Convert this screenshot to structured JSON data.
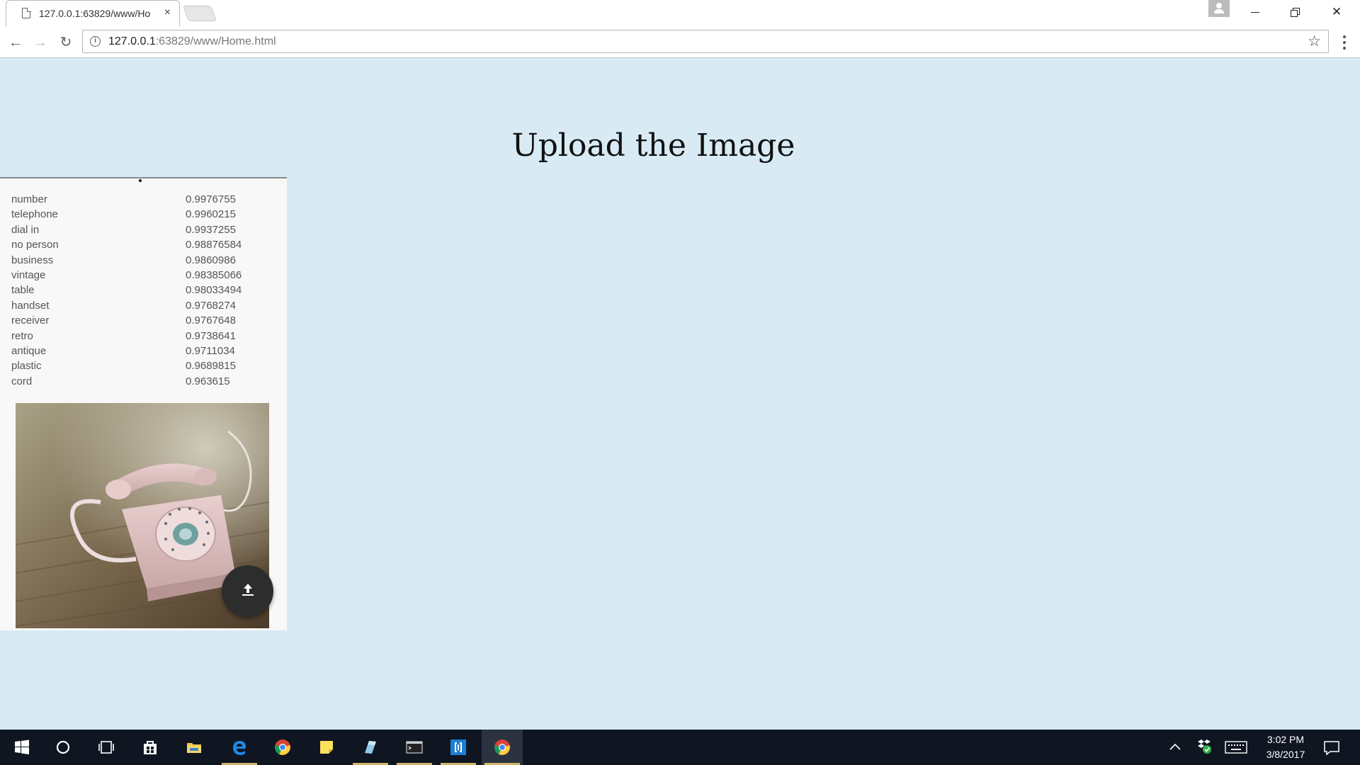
{
  "browser": {
    "tab_title": "127.0.0.1:63829/www/Ho",
    "tab_close": "×",
    "url_host": "127.0.0.1",
    "url_path": ":63829/www/Home.html",
    "info_symbol": "i",
    "star_symbol": "☆",
    "back_symbol": "←",
    "forward_symbol": "→",
    "reload_symbol": "↻",
    "close_symbol": "✕"
  },
  "page": {
    "title": "Upload the Image",
    "labels": [
      {
        "label": "number",
        "score": "0.9976755"
      },
      {
        "label": "telephone",
        "score": "0.9960215"
      },
      {
        "label": "dial in",
        "score": "0.9937255"
      },
      {
        "label": "no person",
        "score": "0.98876584"
      },
      {
        "label": "business",
        "score": "0.9860986"
      },
      {
        "label": "vintage",
        "score": "0.98385066"
      },
      {
        "label": "table",
        "score": "0.98033494"
      },
      {
        "label": "handset",
        "score": "0.9768274"
      },
      {
        "label": "receiver",
        "score": "0.9767648"
      },
      {
        "label": "retro",
        "score": "0.9738641"
      },
      {
        "label": "antique",
        "score": "0.9711034"
      },
      {
        "label": "plastic",
        "score": "0.9689815"
      },
      {
        "label": "cord",
        "score": "0.963615"
      }
    ]
  },
  "taskbar": {
    "time": "3:02 PM",
    "date": "3/8/2017",
    "pinned": [
      "windows-start-icon",
      "cortana-icon",
      "task-view-icon",
      "store-icon",
      "file-explorer-icon",
      "edge-icon",
      "chrome-icon",
      "sticky-notes-icon",
      "app-icon",
      "terminal-icon",
      "bracket-app-icon",
      "chrome-active-icon"
    ]
  },
  "colors": {
    "page_background": "#d8ebf5",
    "card_background": "#f8f8f8",
    "fab": "#2d2d2d",
    "taskbar": "#0f1621"
  }
}
